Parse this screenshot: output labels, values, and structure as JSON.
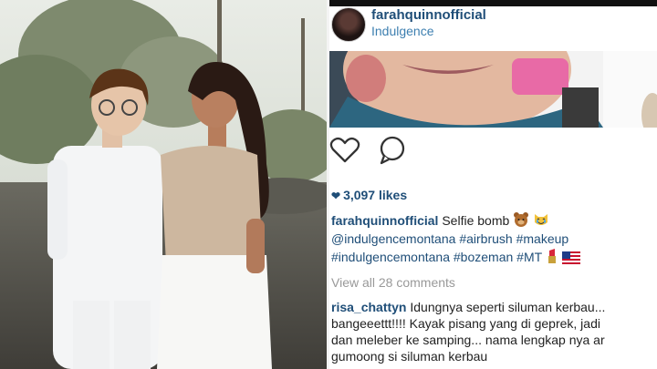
{
  "photo": {
    "description_icon": "couple-photo"
  },
  "post": {
    "username": "farahquinnofficial",
    "location": "Indulgence",
    "likes": "3,097 likes",
    "caption_user": "farahquinnofficial",
    "caption_text": " Selfie bomb ",
    "tag1": "@indulgencemontana",
    "tag2": "#airbrush",
    "tag3": "#makeup",
    "tag4": "#indulgencemontana",
    "tag5": "#bozeman",
    "tag6": "#MT",
    "view_all": "View all 28 comments",
    "comment_user": "risa_chattyn",
    "comment_line1": " Idungnya seperti siluman kerbau...",
    "comment_line2": "bangeeettt!!!! Kayak pisang yang di geprek, jadi",
    "comment_line3": "dan meleber ke samping... nama lengkap nya ar",
    "comment_line4": "gumoong si siluman kerbau"
  },
  "colors": {
    "link": "#1f4e78",
    "location": "#3d7fb0",
    "muted": "#999999"
  },
  "icons": [
    "heart-outline-icon",
    "comment-icon",
    "heart-filled-icon",
    "bear-emoji",
    "cat-emoji",
    "lipstick-emoji",
    "us-flag-emoji"
  ]
}
